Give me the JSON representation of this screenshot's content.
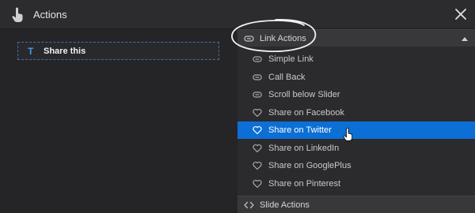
{
  "header": {
    "title": "Actions"
  },
  "layer": {
    "label": "Share this",
    "type_glyph": "T"
  },
  "panel": {
    "sections": [
      {
        "label": "Link Actions"
      },
      {
        "label": "Slide Actions"
      }
    ],
    "items": [
      {
        "label": "Simple Link",
        "icon": "link-icon"
      },
      {
        "label": "Call Back",
        "icon": "link-icon"
      },
      {
        "label": "Scroll below Slider",
        "icon": "link-icon"
      },
      {
        "label": "Share on Facebook",
        "icon": "heart-icon"
      },
      {
        "label": "Share on Twitter",
        "icon": "heart-icon",
        "active": true
      },
      {
        "label": "Share on LinkedIn",
        "icon": "heart-icon"
      },
      {
        "label": "Share on GooglePlus",
        "icon": "heart-icon"
      },
      {
        "label": "Share on Pinterest",
        "icon": "heart-icon"
      }
    ]
  },
  "colors": {
    "accent": "#0c6fd6",
    "background": "#252527",
    "panel": "#2b2b2d",
    "section_header": "#38383b"
  }
}
